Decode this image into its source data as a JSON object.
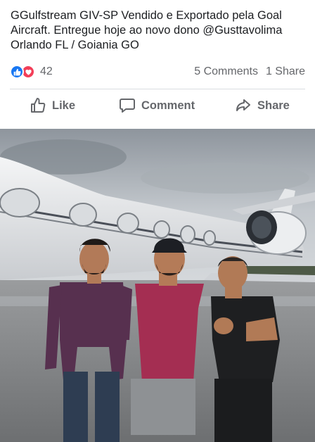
{
  "post": {
    "text": "GGulfstream GIV-SP Vendido e Exportado pela Goal Aircraft. Entregue hoje ao novo dono @Gusttavolima Orlando FL / Goiania GO"
  },
  "reactions": {
    "count": "42",
    "types": [
      "like-icon",
      "love-icon"
    ]
  },
  "stats": {
    "comments": "5 Comments",
    "shares": "1 Share"
  },
  "actions": {
    "like": "Like",
    "comment": "Comment",
    "share": "Share"
  },
  "colors": {
    "like_blue": "#1877f2",
    "love_red": "#f33e58",
    "muted_text": "#65676b"
  }
}
